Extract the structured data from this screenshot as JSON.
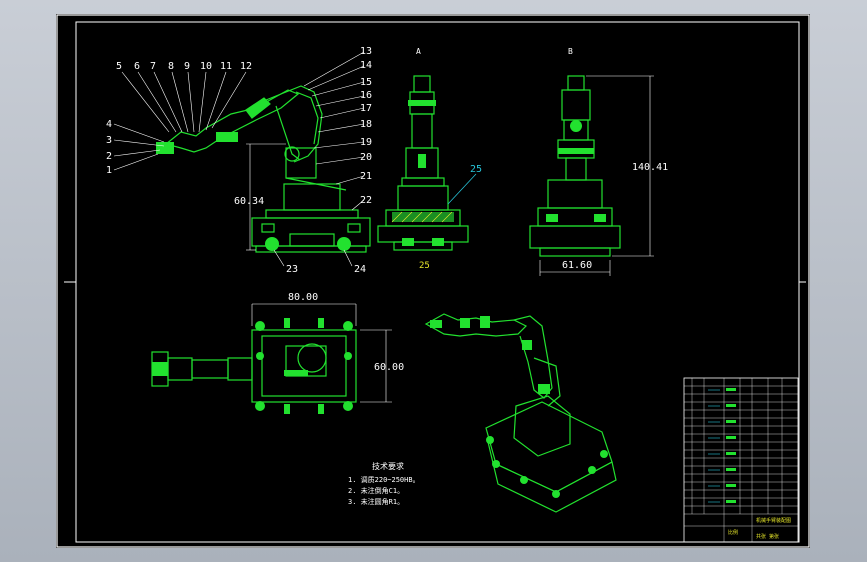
{
  "balloons": [
    "5",
    "6",
    "7",
    "8",
    "9",
    "10",
    "11",
    "12",
    "13",
    "14",
    "15",
    "16",
    "17",
    "18",
    "19",
    "20",
    "21",
    "22",
    "23",
    "24",
    "4",
    "3",
    "2",
    "1",
    "25"
  ],
  "dimensions": {
    "front_height": "60.34",
    "side_height": "140.41",
    "side_width": "61.60",
    "top_width": "80.00",
    "top_height": "60.00"
  },
  "section_marks": [
    "A",
    "B"
  ],
  "notes": {
    "heading": "技术要求",
    "lines": [
      "1. 调质220~250HB。",
      "2. 未注倒角C1。",
      "3. 未注圆角R1。"
    ]
  },
  "title_block": {
    "name_cell": "机械手臂装配图",
    "scale_cell": "比例",
    "sheet_cell": "共张 第张"
  },
  "colors": {
    "background": "#000000",
    "frame": "#ffffff",
    "part": "#22e12f",
    "label": "#e7e72a",
    "accent": "#27c3d8"
  }
}
